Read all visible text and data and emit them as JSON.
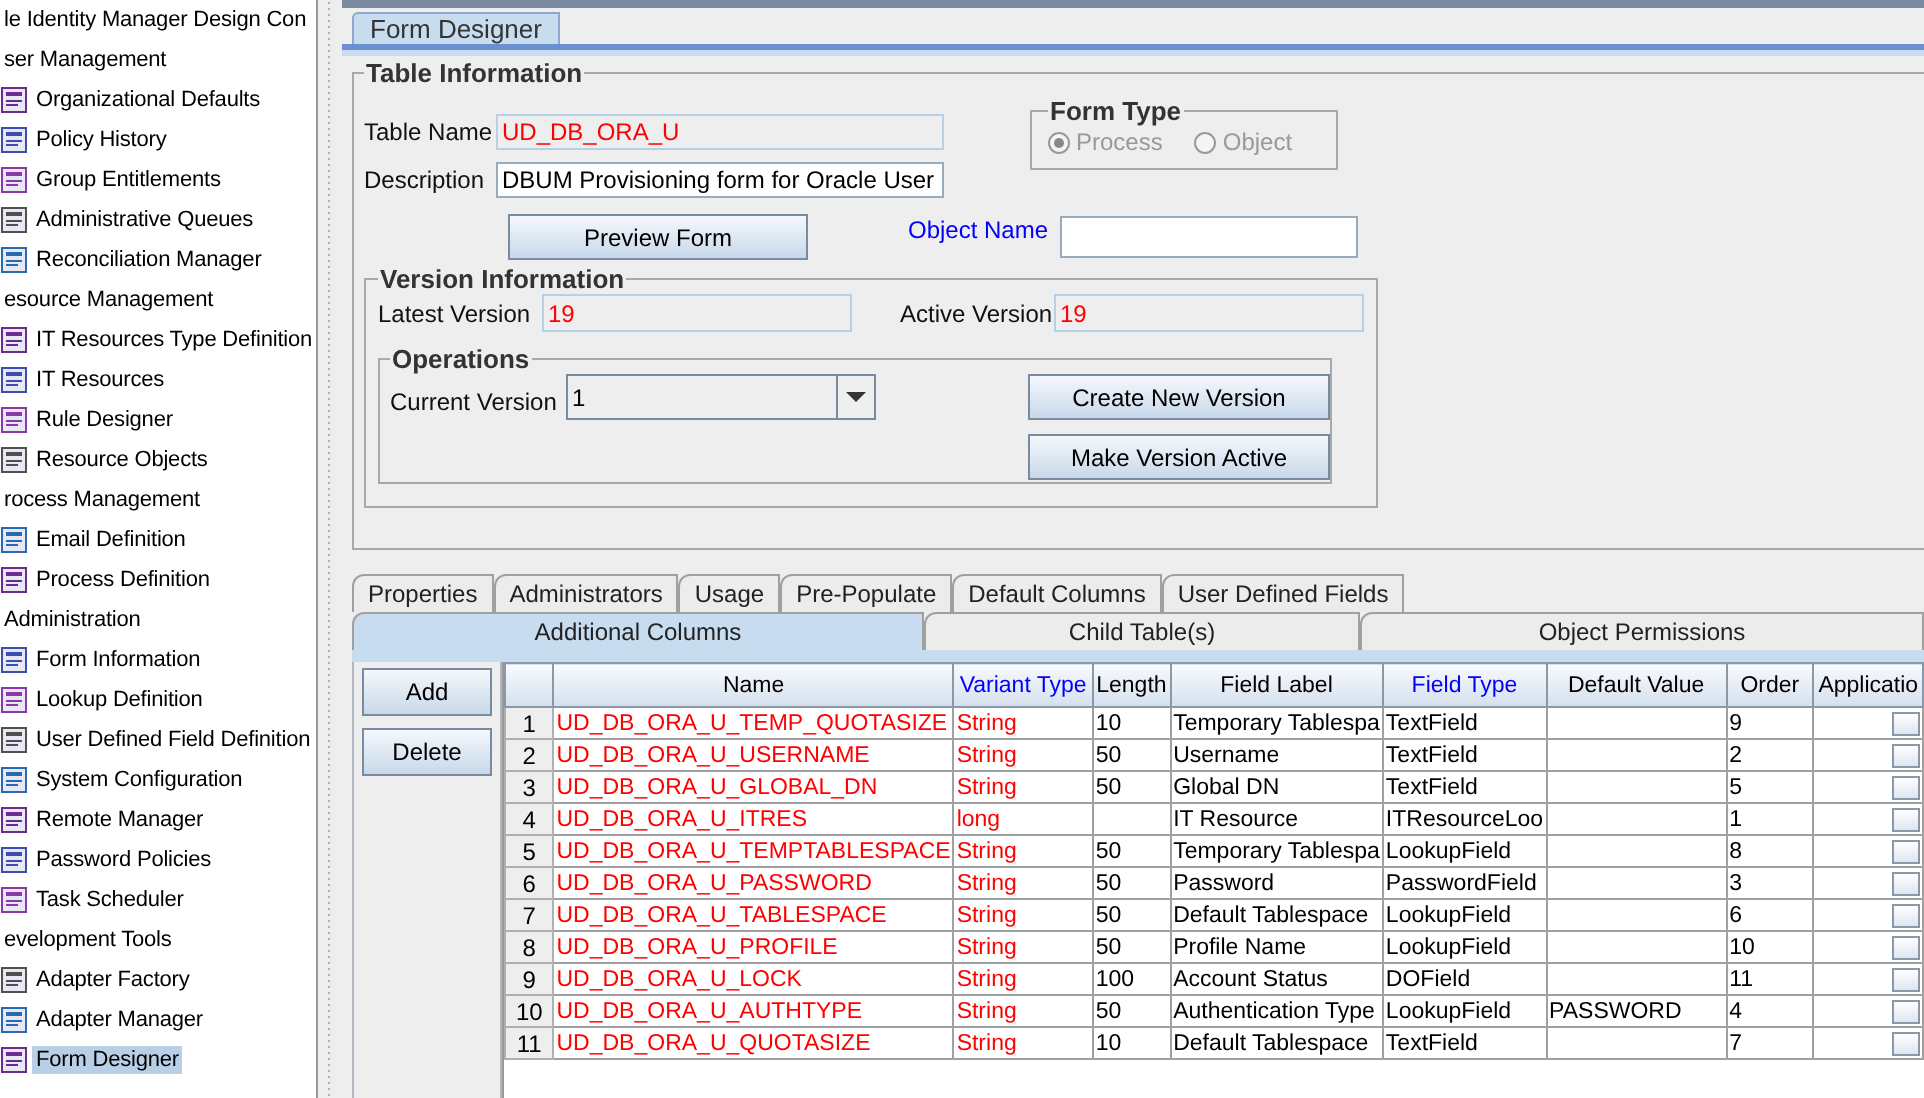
{
  "sidebar": {
    "tree": {
      "label": "le Identity Manager Design Con",
      "selected": false,
      "children": [
        {
          "label": "ser Management",
          "selected": false,
          "children": [
            {
              "label": "Organizational Defaults",
              "selected": false
            },
            {
              "label": "Policy History",
              "selected": false
            },
            {
              "label": "Group Entitlements",
              "selected": false
            },
            {
              "label": "Administrative Queues",
              "selected": false
            },
            {
              "label": "Reconciliation Manager",
              "selected": false
            }
          ]
        },
        {
          "label": "esource Management",
          "selected": false,
          "children": [
            {
              "label": "IT Resources Type Definition",
              "selected": false
            },
            {
              "label": "IT Resources",
              "selected": false
            },
            {
              "label": "Rule Designer",
              "selected": false
            },
            {
              "label": "Resource Objects",
              "selected": false
            }
          ]
        },
        {
          "label": "rocess Management",
          "selected": false,
          "children": [
            {
              "label": "Email Definition",
              "selected": false
            },
            {
              "label": "Process Definition",
              "selected": false
            }
          ]
        },
        {
          "label": "Administration",
          "selected": false,
          "children": [
            {
              "label": "Form Information",
              "selected": false
            },
            {
              "label": "Lookup Definition",
              "selected": false
            },
            {
              "label": "User Defined Field Definition",
              "selected": false
            },
            {
              "label": "System Configuration",
              "selected": false
            },
            {
              "label": "Remote Manager",
              "selected": false
            },
            {
              "label": "Password Policies",
              "selected": false
            },
            {
              "label": "Task Scheduler",
              "selected": false
            }
          ]
        },
        {
          "label": "evelopment Tools",
          "selected": false,
          "children": [
            {
              "label": "Adapter Factory",
              "selected": false
            },
            {
              "label": "Adapter Manager",
              "selected": false
            },
            {
              "label": "Form Designer",
              "selected": true
            }
          ]
        }
      ]
    }
  },
  "window_tabs": [
    {
      "label": "Form Designer",
      "selected": true
    }
  ],
  "table_information": {
    "title": "Table Information",
    "table_name": {
      "label": "Table Name",
      "value": "UD_DB_ORA_U"
    },
    "description": {
      "label": "Description",
      "value": "DBUM Provisioning form for Oracle User"
    },
    "preview_button": "Preview Form",
    "object_name": {
      "label": "Object Name"
    },
    "form_type": {
      "title": "Form Type",
      "disabled": true,
      "options": [
        {
          "label": "Process",
          "selected": true
        },
        {
          "label": "Object",
          "selected": false
        }
      ]
    },
    "version_information": {
      "title": "Version Information",
      "latest_version": {
        "label": "Latest Version",
        "value": "19"
      },
      "active_version": {
        "label": "Active Version",
        "value": "19"
      },
      "operations": {
        "title": "Operations",
        "current_version": {
          "label": "Current Version",
          "value": "1"
        },
        "buttons": [
          "Create New Version",
          "Make Version Active"
        ]
      }
    }
  },
  "detail_tabs": [
    [
      {
        "label": "Properties",
        "selected": false
      },
      {
        "label": "Administrators",
        "selected": false
      },
      {
        "label": "Usage",
        "selected": false
      },
      {
        "label": "Pre-Populate",
        "selected": false
      },
      {
        "label": "Default Columns",
        "selected": false
      },
      {
        "label": "User Defined Fields",
        "selected": false
      }
    ],
    [
      {
        "label": "Additional Columns",
        "selected": true
      },
      {
        "label": "Child Table(s)",
        "selected": false
      },
      {
        "label": "Object Permissions",
        "selected": false
      }
    ]
  ],
  "side_buttons": [
    "Add",
    "Delete"
  ],
  "table": {
    "columns": [
      {
        "label": "Name",
        "linked": false,
        "color": "#ff0000"
      },
      {
        "label": "Variant Type",
        "linked": true,
        "color": "#ff0000"
      },
      {
        "label": "Length",
        "linked": false,
        "color": "#000000"
      },
      {
        "label": "Field Label",
        "linked": false,
        "color": "#000000"
      },
      {
        "label": "Field Type",
        "linked": true,
        "color": "#000000"
      },
      {
        "label": "Default Value",
        "linked": false,
        "color": "#000000"
      },
      {
        "label": "Order",
        "linked": false,
        "color": "#000000"
      },
      {
        "label": "Applicatio",
        "linked": false
      }
    ],
    "rows": [
      {
        "number": "1",
        "cells": [
          "UD_DB_ORA_U_TEMP_QUOTASIZE",
          "String",
          "10",
          "Temporary Tablespa",
          "TextField",
          null,
          "9"
        ]
      },
      {
        "number": "2",
        "cells": [
          "UD_DB_ORA_U_USERNAME",
          "String",
          "50",
          "Username",
          "TextField",
          null,
          "2"
        ]
      },
      {
        "number": "3",
        "cells": [
          "UD_DB_ORA_U_GLOBAL_DN",
          "String",
          "50",
          "Global DN",
          "TextField",
          null,
          "5"
        ]
      },
      {
        "number": "4",
        "cells": [
          "UD_DB_ORA_U_ITRES",
          "long",
          null,
          "IT Resource",
          "ITResourceLoo",
          null,
          "1"
        ]
      },
      {
        "number": "5",
        "cells": [
          "UD_DB_ORA_U_TEMPTABLESPACE",
          "String",
          "50",
          "Temporary Tablespa",
          "LookupField",
          null,
          "8"
        ]
      },
      {
        "number": "6",
        "cells": [
          "UD_DB_ORA_U_PASSWORD",
          "String",
          "50",
          "Password",
          "PasswordField",
          null,
          "3"
        ]
      },
      {
        "number": "7",
        "cells": [
          "UD_DB_ORA_U_TABLESPACE",
          "String",
          "50",
          "Default Tablespace",
          "LookupField",
          null,
          "6"
        ]
      },
      {
        "number": "8",
        "cells": [
          "UD_DB_ORA_U_PROFILE",
          "String",
          "50",
          "Profile Name",
          "LookupField",
          null,
          "10"
        ]
      },
      {
        "number": "9",
        "cells": [
          "UD_DB_ORA_U_LOCK",
          "String",
          "100",
          "Account Status",
          "DOField",
          null,
          "11"
        ]
      },
      {
        "number": "10",
        "cells": [
          "UD_DB_ORA_U_AUTHTYPE",
          "String",
          "50",
          "Authentication Type",
          "LookupField",
          "PASSWORD",
          "4"
        ]
      },
      {
        "number": "11",
        "cells": [
          "UD_DB_ORA_U_QUOTASIZE",
          "String",
          "10",
          "Default Tablespace",
          "TextField",
          null,
          "7"
        ]
      }
    ]
  }
}
